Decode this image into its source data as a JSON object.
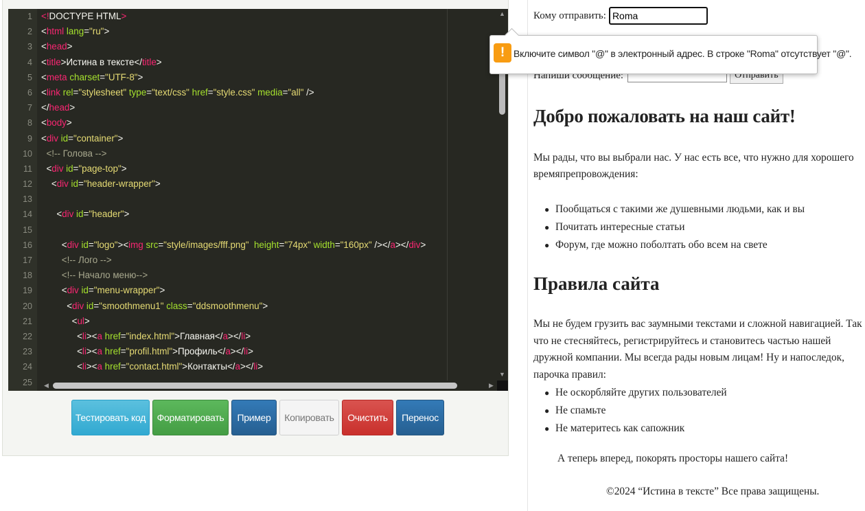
{
  "editor": {
    "line_numbers": [
      "1",
      "2",
      "3",
      "4",
      "5",
      "6",
      "7",
      "8",
      "9",
      "10",
      "11",
      "12",
      "13",
      "14",
      "15",
      "16",
      "17",
      "18",
      "19",
      "20",
      "21",
      "22",
      "23",
      "24",
      "25"
    ],
    "lines": [
      [
        [
          "tag",
          "<!"
        ],
        [
          "",
          "DOCTYPE HTML"
        ],
        [
          "tag",
          ">"
        ]
      ],
      [
        [
          "",
          "<"
        ],
        [
          "tag",
          "html"
        ],
        [
          "attr",
          " lang"
        ],
        [
          "",
          "="
        ],
        [
          "str",
          "\"ru\""
        ],
        [
          "",
          ">"
        ]
      ],
      [
        [
          "",
          "<"
        ],
        [
          "tag",
          "head"
        ],
        [
          "",
          ">"
        ]
      ],
      [
        [
          "",
          "<"
        ],
        [
          "tag",
          "title"
        ],
        [
          "",
          ">Истина в тексте</"
        ],
        [
          "tag",
          "title"
        ],
        [
          "",
          ">"
        ]
      ],
      [
        [
          "",
          "<"
        ],
        [
          "tag",
          "meta"
        ],
        [
          "attr",
          " charset"
        ],
        [
          "",
          "="
        ],
        [
          "str",
          "\"UTF-8\""
        ],
        [
          "",
          ">"
        ]
      ],
      [
        [
          "",
          "<"
        ],
        [
          "tag",
          "link"
        ],
        [
          "attr",
          " rel"
        ],
        [
          "",
          "="
        ],
        [
          "str",
          "\"stylesheet\""
        ],
        [
          "attr",
          " type"
        ],
        [
          "",
          "="
        ],
        [
          "str",
          "\"text/css\""
        ],
        [
          "attr",
          " href"
        ],
        [
          "",
          "="
        ],
        [
          "str",
          "\"style.css\""
        ],
        [
          "attr",
          " media"
        ],
        [
          "",
          "="
        ],
        [
          "str",
          "\"all\""
        ],
        [
          "",
          " />"
        ]
      ],
      [
        [
          "",
          "</"
        ],
        [
          "tag",
          "head"
        ],
        [
          "",
          ">"
        ]
      ],
      [
        [
          "",
          "<"
        ],
        [
          "tag",
          "body"
        ],
        [
          "",
          ">"
        ]
      ],
      [
        [
          "",
          "<"
        ],
        [
          "tag",
          "div"
        ],
        [
          "attr",
          " id"
        ],
        [
          "",
          "="
        ],
        [
          "str",
          "\"container\""
        ],
        [
          "",
          ">"
        ]
      ],
      [
        [
          "",
          "  "
        ],
        [
          "cm",
          "<!-- Голова -->"
        ]
      ],
      [
        [
          "",
          "  <"
        ],
        [
          "tag",
          "div"
        ],
        [
          "attr",
          " id"
        ],
        [
          "",
          "="
        ],
        [
          "str",
          "\"page-top\""
        ],
        [
          "",
          ">"
        ]
      ],
      [
        [
          "",
          "    <"
        ],
        [
          "tag",
          "div"
        ],
        [
          "attr",
          " id"
        ],
        [
          "",
          "="
        ],
        [
          "str",
          "\"header-wrapper\""
        ],
        [
          "",
          ">"
        ]
      ],
      [
        [
          "",
          ""
        ]
      ],
      [
        [
          "",
          "      <"
        ],
        [
          "tag",
          "div"
        ],
        [
          "attr",
          " id"
        ],
        [
          "",
          "="
        ],
        [
          "str",
          "\"header\""
        ],
        [
          "",
          ">"
        ]
      ],
      [
        [
          "",
          ""
        ]
      ],
      [
        [
          "",
          "        <"
        ],
        [
          "tag",
          "div"
        ],
        [
          "attr",
          " id"
        ],
        [
          "",
          "="
        ],
        [
          "str",
          "\"logo\""
        ],
        [
          "",
          "><"
        ],
        [
          "tag",
          "img"
        ],
        [
          "attr",
          " src"
        ],
        [
          "",
          "="
        ],
        [
          "str",
          "\"style/images/fff.png\""
        ],
        [
          "attr",
          "  height"
        ],
        [
          "",
          "="
        ],
        [
          "str",
          "\"74px\""
        ],
        [
          "attr",
          " width"
        ],
        [
          "",
          "="
        ],
        [
          "str",
          "\"160px\""
        ],
        [
          "",
          " /></"
        ],
        [
          "tag",
          "a"
        ],
        [
          "",
          "></"
        ],
        [
          "tag",
          "div"
        ],
        [
          "",
          ">"
        ]
      ],
      [
        [
          "",
          "        "
        ],
        [
          "cm",
          "<!-- Лого -->"
        ]
      ],
      [
        [
          "",
          "        "
        ],
        [
          "cm",
          "<!-- Начало меню-->"
        ]
      ],
      [
        [
          "",
          "        <"
        ],
        [
          "tag",
          "div"
        ],
        [
          "attr",
          " id"
        ],
        [
          "",
          "="
        ],
        [
          "str",
          "\"menu-wrapper\""
        ],
        [
          "",
          ">"
        ]
      ],
      [
        [
          "",
          "          <"
        ],
        [
          "tag",
          "div"
        ],
        [
          "attr",
          " id"
        ],
        [
          "",
          "="
        ],
        [
          "str",
          "\"smoothmenu1\""
        ],
        [
          "attr",
          " class"
        ],
        [
          "",
          "="
        ],
        [
          "str",
          "\"ddsmoothmenu\""
        ],
        [
          "",
          ">"
        ]
      ],
      [
        [
          "",
          "            <"
        ],
        [
          "tag",
          "ul"
        ],
        [
          "",
          ">"
        ]
      ],
      [
        [
          "",
          "              <"
        ],
        [
          "tag",
          "li"
        ],
        [
          "",
          "><"
        ],
        [
          "tag",
          "a"
        ],
        [
          "attr",
          " href"
        ],
        [
          "",
          "="
        ],
        [
          "str",
          "\"index.html\""
        ],
        [
          "",
          ">Главная</"
        ],
        [
          "tag",
          "a"
        ],
        [
          "",
          "></"
        ],
        [
          "tag",
          "li"
        ],
        [
          "",
          ">"
        ]
      ],
      [
        [
          "",
          "              <"
        ],
        [
          "tag",
          "li"
        ],
        [
          "",
          "><"
        ],
        [
          "tag",
          "a"
        ],
        [
          "attr",
          " href"
        ],
        [
          "",
          "="
        ],
        [
          "str",
          "\"profil.html\""
        ],
        [
          "",
          ">Профиль</"
        ],
        [
          "tag",
          "a"
        ],
        [
          "",
          "></"
        ],
        [
          "tag",
          "li"
        ],
        [
          "",
          ">"
        ]
      ],
      [
        [
          "",
          "              <"
        ],
        [
          "tag",
          "li"
        ],
        [
          "",
          "><"
        ],
        [
          "tag",
          "a"
        ],
        [
          "attr",
          " href"
        ],
        [
          "",
          "="
        ],
        [
          "str",
          "\"contact.html\""
        ],
        [
          "",
          ">Контакты</"
        ],
        [
          "tag",
          "a"
        ],
        [
          "",
          "></"
        ],
        [
          "tag",
          "li"
        ],
        [
          "",
          ">"
        ]
      ]
    ]
  },
  "buttons": {
    "test": "Тестировать код",
    "format": "Форматировать",
    "example": "Пример",
    "copy": "Копировать",
    "clear": "Очистить",
    "wrap": "Перенос"
  },
  "preview": {
    "to_label": "Кому отправить:",
    "to_value": "Roma",
    "message_label": "Напиши сообщение:",
    "send_label": "Отправить",
    "welcome_heading": "Добро пожаловать на наш сайт!",
    "intro": "Мы рады, что вы выбрали нас. У нас есть все, что нужно для хорошего времяпрепровождения:",
    "features": [
      "Пообщаться с такими же душевными людьми, как и вы",
      "Почитать интересные статьи",
      "Форум, где можно поболтать обо всем на свете"
    ],
    "rules_heading": "Правила сайта",
    "rules_intro": "Мы не будем грузить вас заумными текстами и сложной навигацией. Так что не стесняйтесь, регистрируйтесь и становитесь частью нашей дружной компании. Мы всегда рады новым лицам! Ну и напоследок, парочка правил:",
    "rules": [
      "Не оскорбляйте других пользователей",
      "Не спамьте",
      "Не материтесь как сапожник"
    ],
    "final": "А теперь вперед, покорять просторы нашего сайта!",
    "footer": "©2024 “Истина в тексте” Все права защищены."
  },
  "tooltip": {
    "icon": "warning-icon",
    "icon_glyph": "!",
    "message": "Включите символ \"@\" в электронный адрес. В строке \"Roma\" отсутствует \"@\"."
  },
  "colors": {
    "editor_bg": "#272822",
    "tag": "#f92672",
    "attr": "#a6e22e",
    "string": "#e6db74",
    "warning": "#f89c12"
  }
}
